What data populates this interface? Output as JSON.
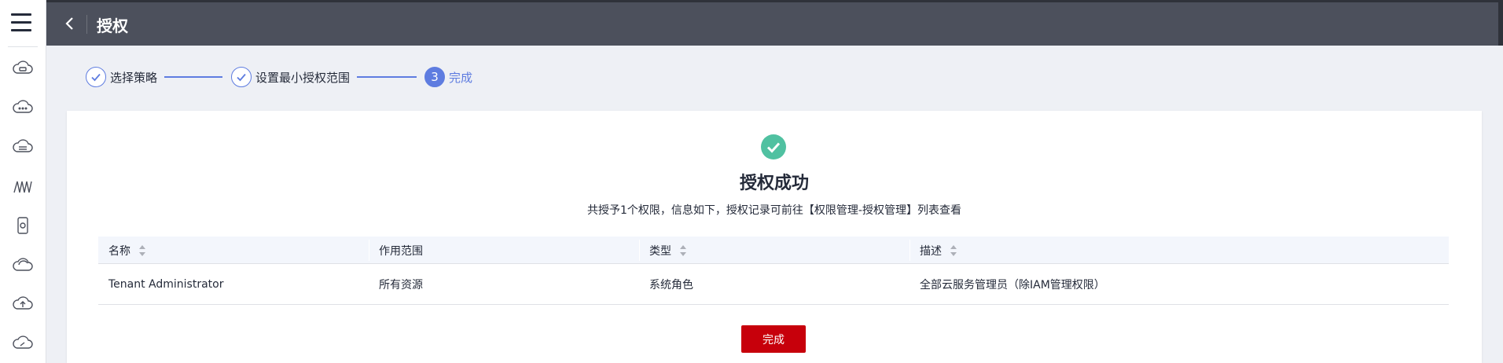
{
  "header": {
    "title": "授权"
  },
  "steps": [
    {
      "label": "选择策略",
      "state": "done"
    },
    {
      "label": "设置最小授权范围",
      "state": "done"
    },
    {
      "number": "3",
      "label": "完成",
      "state": "active"
    }
  ],
  "result": {
    "title": "授权成功",
    "description": "共授予1个权限，信息如下，授权记录可前往【权限管理-授权管理】列表查看"
  },
  "table": {
    "columns": [
      "名称",
      "作用范围",
      "类型",
      "描述"
    ],
    "rows": [
      [
        "Tenant Administrator",
        "所有资源",
        "系统角色",
        "全部云服务管理员（除IAM管理权限）"
      ]
    ]
  },
  "actions": {
    "done_label": "完成"
  },
  "colors": {
    "accent": "#5e7ce0",
    "success": "#50c1a1",
    "primary_button": "#c7000b",
    "header": "#4c505c"
  },
  "icons": [
    "menu-icon",
    "cloud-server-icon",
    "cloud-more-icon",
    "cloud-database-icon",
    "network-icon",
    "storage-icon",
    "cloud-layers-icon",
    "cloud-upload-icon",
    "cloud-refresh-icon",
    "back-arrow-icon",
    "check-icon",
    "sort-icon"
  ]
}
